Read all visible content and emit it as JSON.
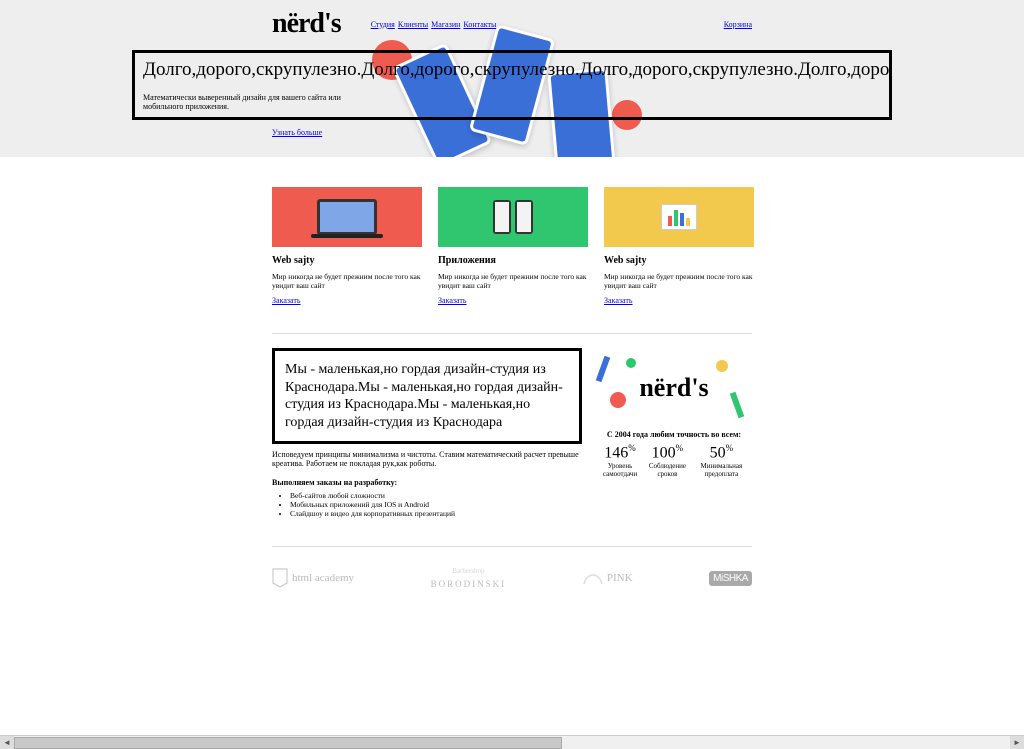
{
  "brand": "nërd's",
  "nav": {
    "items": [
      "Студия",
      "Клиенты",
      "Магазин",
      "Контакты"
    ],
    "basket": "Корзина"
  },
  "hero": {
    "headline": "Долго,дорого,скрупулезно.Долго,дорого,скрупулезно.Долго,дорого,скрупулезно.Долго,дорого,с",
    "sub": "Математически выверенный дизайн для вашего сайта или мобильного приложения.",
    "more": "Узнать больше"
  },
  "services": [
    {
      "title": "Web sajty",
      "desc": "Мир никогда не будет прежним после того как увидит ваш сайт",
      "cta": "Заказать"
    },
    {
      "title": "Приложения",
      "desc": "Мир никогда не будет прежним после того как увидит ваш сайт",
      "cta": "Заказать"
    },
    {
      "title": "Web sajty",
      "desc": "Мир никогда не будет прежним после того как увидит ваш сайт",
      "cta": "Заказать"
    }
  ],
  "about": {
    "box": "Мы - маленькая,но гордая дизайн-студия из Краснодара.Мы - маленькая,но гордая дизайн-студия из Краснодара.Мы - маленькая,но гордая дизайн-студия из Краснодара",
    "para": "Исповедуем принципы минимализма и чистоты. Ставим математический расчет превыше креатива. Работаем не покладая рук,как роботы.",
    "sub_heading": "Выполняем заказы на разработку:",
    "bullets": [
      "Веб-сайтов любой сложности",
      "Мобильных приложений для IOS и Android",
      "Слайдшоу и видео для корпоративных презентаций"
    ]
  },
  "since": "С 2004 года любим точность во всем:",
  "stats": [
    {
      "num": "146",
      "pct": "%",
      "lbl": "Уровень самоотдачи"
    },
    {
      "num": "100",
      "pct": "%",
      "lbl": "Соблюдение сроков"
    },
    {
      "num": "50",
      "pct": "%",
      "lbl": "Минимальная предоплата"
    }
  ],
  "clients": {
    "c0": {
      "top": "",
      "name": "html academy"
    },
    "c1": {
      "top": "Barbershop",
      "name": "BORODINSKI"
    },
    "c2": {
      "top": "",
      "name": "PINK"
    },
    "c3": {
      "top": "",
      "name": "MiSHKA"
    }
  }
}
